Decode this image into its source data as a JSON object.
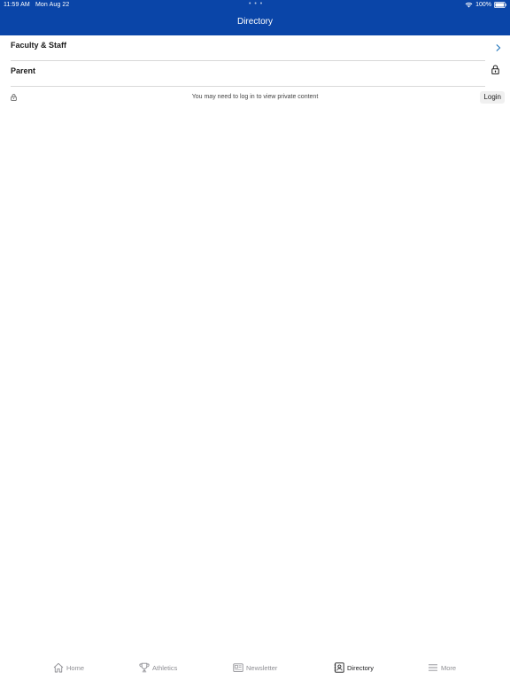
{
  "status_bar": {
    "time": "11:59 AM",
    "date": "Mon Aug 22",
    "dots": "• • •",
    "battery": "100%"
  },
  "header": {
    "title": "Directory",
    "background": "#0a45a8"
  },
  "directory": {
    "items": [
      {
        "label": "Faculty & Staff",
        "icon": "chevron-right-icon"
      },
      {
        "label": "Parent",
        "icon": "lock-icon"
      }
    ]
  },
  "notice": {
    "text": "You may need to log in to view private content",
    "login_label": "Login"
  },
  "tab_bar": {
    "active": "Directory",
    "tabs": [
      {
        "label": "Home",
        "icon": "home-icon"
      },
      {
        "label": "Athletics",
        "icon": "trophy-icon"
      },
      {
        "label": "Newsletter",
        "icon": "newsletter-icon"
      },
      {
        "label": "Directory",
        "icon": "directory-icon"
      },
      {
        "label": "More",
        "icon": "menu-icon"
      }
    ]
  }
}
